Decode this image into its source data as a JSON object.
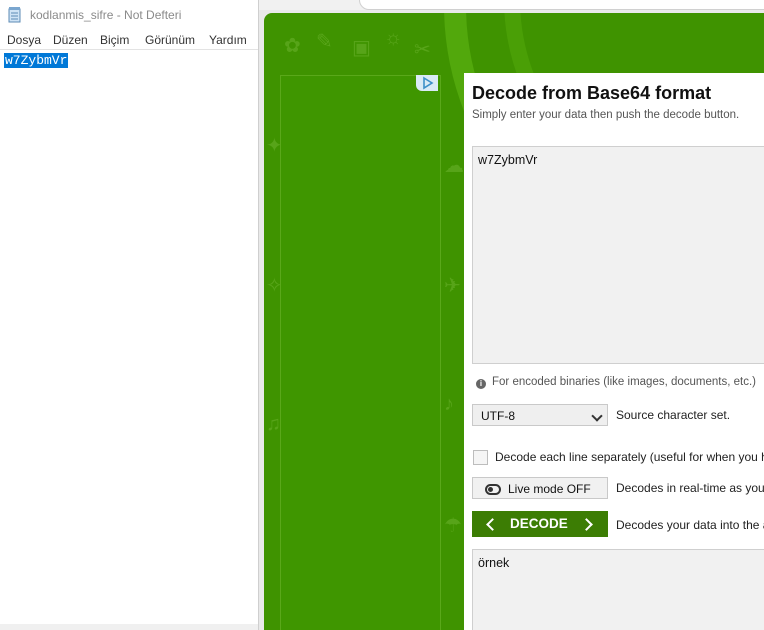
{
  "notepad": {
    "title": "kodlanmis_sifre - Not Defteri",
    "menu": [
      "Dosya",
      "Düzen",
      "Biçim",
      "Görünüm",
      "Yardım"
    ],
    "content": "w7ZybmVr"
  },
  "decoder": {
    "title": "Decode from Base64 format",
    "subtitle": "Simply enter your data then push the decode button.",
    "input_value": "w7ZybmVr",
    "binaries_note": "For encoded binaries (like images, documents, etc.)",
    "charset": {
      "selected": "UTF-8",
      "label": "Source character set."
    },
    "line_option_label": "Decode each line separately (useful for when you h",
    "live_mode": {
      "label": "Live mode OFF",
      "description": "Decodes in real-time as you t"
    },
    "decode_button": {
      "label": "DECODE",
      "description": "Decodes your data into the a"
    },
    "output_value": "örnek"
  },
  "colors": {
    "site_green": "#3f9300",
    "decode_button": "#3c7d04",
    "selection": "#0078d7"
  }
}
